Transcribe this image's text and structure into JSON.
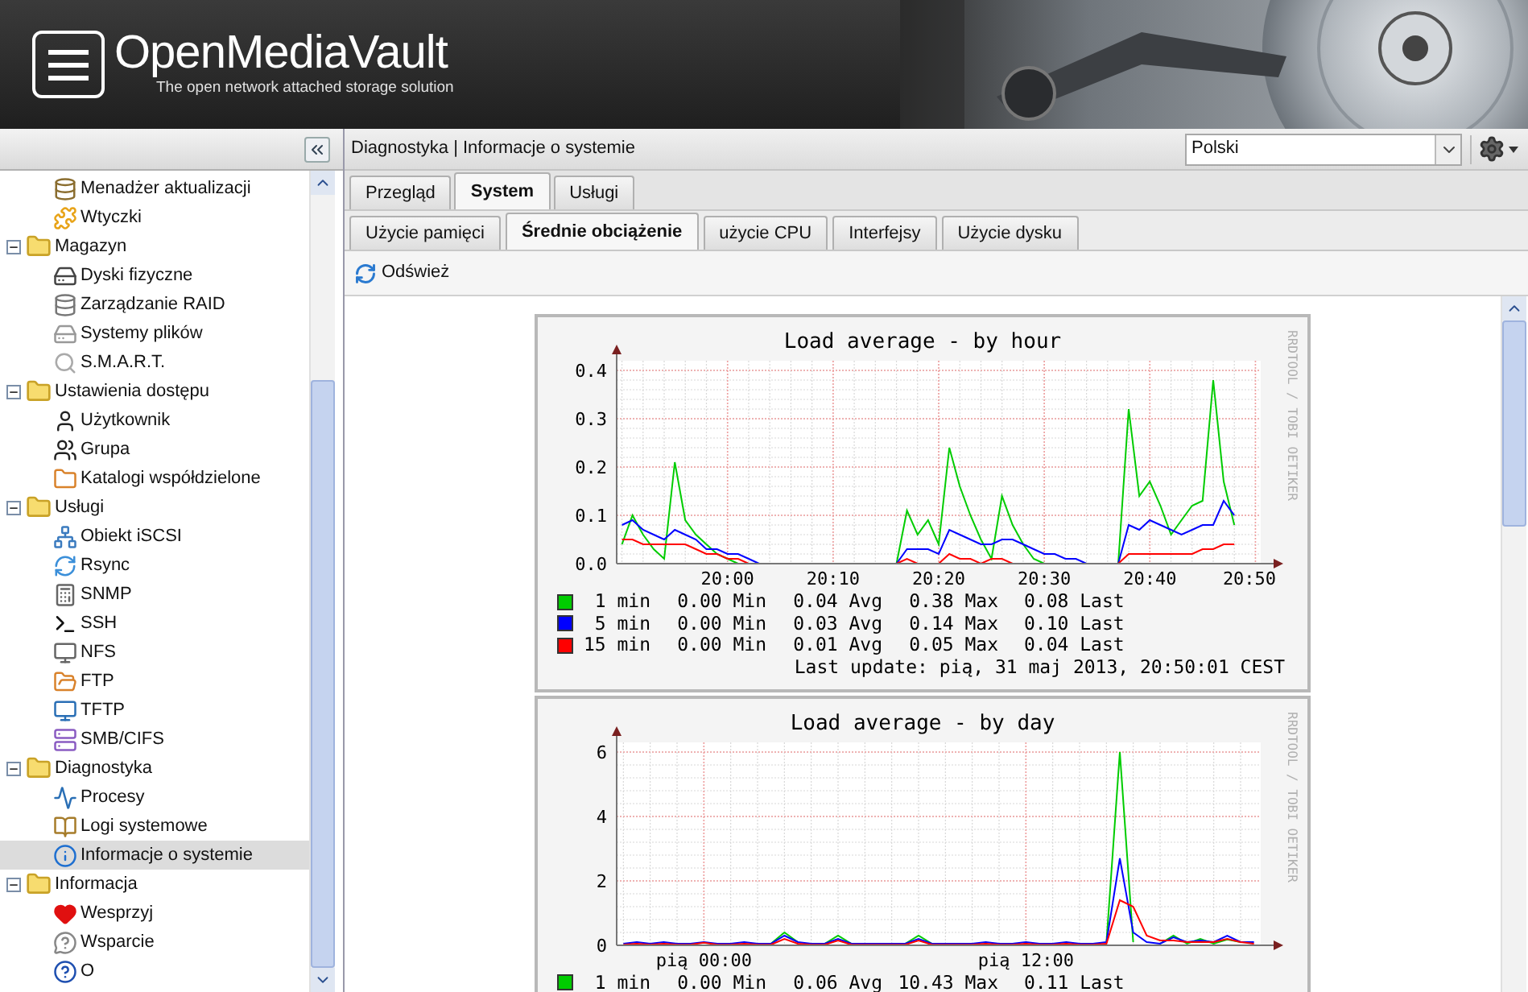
{
  "header": {
    "title": "OpenMediaVault",
    "subtitle": "The open network attached storage solution"
  },
  "navigation": {
    "tree": [
      {
        "children": [
          {
            "label": "Menadżer aktualizacji",
            "selected": false
          },
          {
            "label": "Wtyczki",
            "selected": false
          }
        ]
      },
      {
        "label": "Magazyn",
        "expanded": true,
        "children": [
          {
            "label": "Dyski fizyczne",
            "selected": false
          },
          {
            "label": "Zarządzanie RAID",
            "selected": false
          },
          {
            "label": "Systemy plików",
            "selected": false
          },
          {
            "label": "S.M.A.R.T.",
            "selected": false
          }
        ]
      },
      {
        "label": "Ustawienia dostępu",
        "expanded": true,
        "children": [
          {
            "label": "Użytkownik",
            "selected": false
          },
          {
            "label": "Grupa",
            "selected": false
          },
          {
            "label": "Katalogi współdzielone",
            "selected": false
          }
        ]
      },
      {
        "label": "Usługi",
        "expanded": true,
        "children": [
          {
            "label": "Obiekt iSCSI",
            "selected": false
          },
          {
            "label": "Rsync",
            "selected": false
          },
          {
            "label": "SNMP",
            "selected": false
          },
          {
            "label": "SSH",
            "selected": false
          },
          {
            "label": "NFS",
            "selected": false
          },
          {
            "label": "FTP",
            "selected": false
          },
          {
            "label": "TFTP",
            "selected": false
          },
          {
            "label": "SMB/CIFS",
            "selected": false
          }
        ]
      },
      {
        "label": "Diagnostyka",
        "expanded": true,
        "children": [
          {
            "label": "Procesy",
            "selected": false
          },
          {
            "label": "Logi systemowe",
            "selected": false
          },
          {
            "label": "Informacje o systemie",
            "selected": true
          }
        ]
      },
      {
        "label": "Informacja",
        "expanded": true,
        "children": [
          {
            "label": "Wesprzyj",
            "selected": false
          },
          {
            "label": "Wsparcie",
            "selected": false
          },
          {
            "label": "O",
            "selected": false
          }
        ]
      }
    ]
  },
  "breadcrumb": "Diagnostyka | Informacje o systemie",
  "language_select": {
    "value": "Polski"
  },
  "tabs": [
    {
      "label": "Przegląd",
      "selected": false
    },
    {
      "label": "System",
      "selected": true
    },
    {
      "label": "Usługi",
      "selected": false
    }
  ],
  "subtabs": [
    {
      "label": "Użycie pamięci",
      "selected": false
    },
    {
      "label": "Średnie obciążenie",
      "selected": true
    },
    {
      "label": "użycie CPU",
      "selected": false
    },
    {
      "label": "Interfejsy",
      "selected": false
    },
    {
      "label": "Użycie dysku",
      "selected": false
    }
  ],
  "toolbar": {
    "refresh": "Odśwież"
  },
  "graphs": [
    {
      "side_label": "RRDTOOL / TOBI OETIKER",
      "chart_data": {
        "type": "line",
        "title": "Load average - by hour",
        "categories": [
          null,
          null,
          null,
          null,
          null,
          null,
          null,
          null,
          null,
          null,
          "20:00",
          null,
          null,
          null,
          null,
          null,
          null,
          null,
          null,
          null,
          "20:10",
          null,
          null,
          null,
          null,
          null,
          null,
          null,
          null,
          null,
          "20:20",
          null,
          null,
          null,
          null,
          null,
          null,
          null,
          null,
          null,
          "20:30",
          null,
          null,
          null,
          null,
          null,
          null,
          null,
          null,
          null,
          "20:40",
          null,
          null,
          null,
          null,
          null,
          null,
          null,
          null,
          null,
          "20:50"
        ],
        "series": [
          {
            "name": "1 min",
            "color": "#00cc00",
            "values": [
              0.04,
              0.1,
              0.06,
              0.03,
              0.01,
              0.21,
              0.09,
              0.06,
              0.04,
              0.02,
              0.01,
              0,
              0,
              0,
              0,
              0,
              0,
              0,
              0,
              0,
              0,
              0,
              0,
              0,
              0,
              0,
              0,
              0.11,
              0.06,
              0.09,
              0.04,
              0.24,
              0.16,
              0.1,
              0.05,
              0.01,
              0.14,
              0.08,
              0.04,
              0.01,
              0,
              0,
              0,
              0,
              0,
              0,
              0,
              0,
              0.32,
              0.14,
              0.17,
              0.12,
              0.06,
              0.09,
              0.12,
              0.13,
              0.38,
              0.17,
              0.08,
              null,
              null
            ]
          },
          {
            "name": "5 min",
            "color": "#0000ff",
            "values": [
              0.08,
              0.09,
              0.07,
              0.06,
              0.05,
              0.07,
              0.06,
              0.05,
              0.03,
              0.03,
              0.02,
              0.02,
              0.01,
              0,
              0,
              0,
              0,
              0,
              0,
              0,
              0,
              0,
              0,
              0,
              0,
              0,
              0,
              0.03,
              0.03,
              0.03,
              0.02,
              0.07,
              0.06,
              0.05,
              0.04,
              0.04,
              0.05,
              0.05,
              0.04,
              0.03,
              0.02,
              0.02,
              0.01,
              0.01,
              0,
              0,
              0,
              0,
              0.08,
              0.07,
              0.09,
              0.08,
              0.07,
              0.06,
              0.07,
              0.08,
              0.08,
              0.13,
              0.1,
              null,
              null
            ]
          },
          {
            "name": "15 min",
            "color": "#ff0000",
            "values": [
              0.05,
              0.05,
              0.04,
              0.04,
              0.04,
              0.04,
              0.04,
              0.03,
              0.02,
              0.02,
              0.01,
              0.01,
              0,
              0,
              0,
              0,
              0,
              0,
              0,
              0,
              0,
              0,
              0,
              0,
              0,
              0,
              0,
              0.01,
              0,
              0,
              0,
              0.02,
              0.01,
              0.01,
              0,
              0.01,
              0.01,
              0,
              0,
              0,
              0,
              0,
              0,
              0,
              0,
              0,
              0,
              0,
              0.02,
              0.02,
              0.02,
              0.02,
              0.02,
              0.02,
              0.02,
              0.03,
              0.03,
              0.04,
              0.04,
              null,
              null
            ]
          }
        ],
        "ylim": [
          0,
          0.42
        ],
        "grid": true,
        "yticks": [
          {
            "value": 0,
            "label": "0.0"
          },
          {
            "value": 0.1,
            "label": "0.1"
          },
          {
            "value": 0.2,
            "label": "0.2"
          },
          {
            "value": 0.3,
            "label": "0.3"
          },
          {
            "value": 0.4,
            "label": "0.4"
          }
        ]
      },
      "legend": [
        {
          "min": "0.00 Min",
          "avg": "0.04 Avg",
          "max": "0.38 Max",
          "last": "0.08 Last"
        },
        {
          "min": "0.00 Min",
          "avg": "0.03 Avg",
          "max": "0.14 Max",
          "last": "0.10 Last"
        },
        {
          "min": "0.00 Min",
          "avg": "0.01 Avg",
          "max": "0.05 Max",
          "last": "0.04 Last"
        }
      ],
      "last_update": "Last update: pią, 31 maj 2013, 20:50:01 CEST"
    },
    {
      "side_label": "RRDTOOL / TOBI OETIKER",
      "chart_data": {
        "type": "line",
        "title": "Load average - by day",
        "categories": [
          null,
          null,
          null,
          null,
          null,
          null,
          "pią 00:00",
          null,
          null,
          null,
          null,
          null,
          null,
          null,
          null,
          null,
          null,
          null,
          null,
          null,
          null,
          null,
          null,
          null,
          null,
          null,
          null,
          null,
          null,
          null,
          "pią 12:00",
          null,
          null,
          null,
          null,
          null,
          null,
          null,
          null,
          null,
          null,
          null,
          null,
          null,
          null,
          null,
          null,
          null
        ],
        "series": [
          {
            "name": "1 min",
            "color": "#00cc00",
            "values": [
              null,
              null,
              null,
              null,
              null,
              null,
              null,
              null,
              null,
              null,
              null,
              0.05,
              0.4,
              0.1,
              null,
              0.05,
              0.3,
              0.05,
              null,
              null,
              null,
              0.05,
              0.3,
              0.05,
              null,
              null,
              null,
              null,
              null,
              null,
              null,
              null,
              null,
              null,
              null,
              null,
              0.1,
              6.0,
              0.1,
              null,
              0.05,
              0.3,
              0.05,
              0.2,
              0.05,
              0.18,
              0.1,
              null
            ]
          },
          {
            "color": "#0000ff",
            "values": [
              0.05,
              0.1,
              0.05,
              0.1,
              0.05,
              0.05,
              0.1,
              0.05,
              0.05,
              0.1,
              0.05,
              0.05,
              0.3,
              0.1,
              0.05,
              0.05,
              0.2,
              0.05,
              0.05,
              0.05,
              0.05,
              0.05,
              0.2,
              0.05,
              0.05,
              0.05,
              0.05,
              0.1,
              0.05,
              0.05,
              0.1,
              0.05,
              0.05,
              0.1,
              0.05,
              0.05,
              0.1,
              2.7,
              0.4,
              0.1,
              0.05,
              0.25,
              0.1,
              0.15,
              0.1,
              0.3,
              0.1,
              0.1
            ]
          },
          {
            "color": "#ff0000",
            "values": [
              0.02,
              0.05,
              0.02,
              0.05,
              0.02,
              0.02,
              0.08,
              0.02,
              0.02,
              0.05,
              0.02,
              0.02,
              0.2,
              0.05,
              0.02,
              0.02,
              0.15,
              0.02,
              0.02,
              0.02,
              0.02,
              0.02,
              0.15,
              0.02,
              0.02,
              0.02,
              0.02,
              0.05,
              0.02,
              0.02,
              0.05,
              0.02,
              0.02,
              0.05,
              0.02,
              0.02,
              0.05,
              1.4,
              1.2,
              0.3,
              0.15,
              0.15,
              0.1,
              0.1,
              0.1,
              0.2,
              0.1,
              0.05
            ]
          }
        ],
        "ylim": [
          0,
          6.3
        ],
        "grid": true,
        "yticks": [
          0,
          2,
          4,
          6
        ]
      },
      "legend": [
        {
          "min": "0.00 Min",
          "avg": "0.06 Avg",
          "max": "10.43 Max",
          "last": "0.11 Last"
        }
      ]
    }
  ]
}
